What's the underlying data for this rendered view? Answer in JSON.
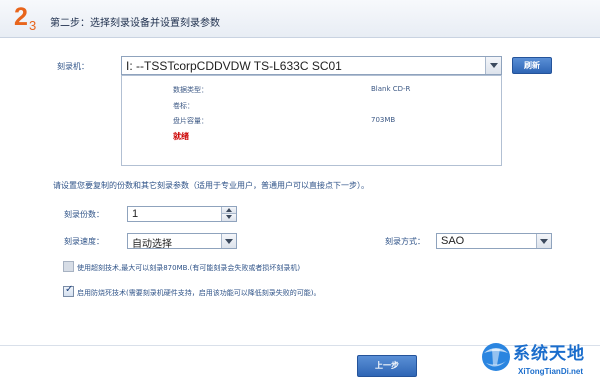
{
  "header": {
    "step_current": "2",
    "step_total": "3",
    "title": "第二步：选择刻录设备并设置刻录参数"
  },
  "burner": {
    "label": "刻录机：",
    "selected": "I:  --TSSTcorpCDDVDW TS-L633C  SC01",
    "refresh_label": "刷新"
  },
  "disc_info": {
    "data_type_label": "数据类型：",
    "data_type_value": "Blank CD-R",
    "volume_label_label": "卷标：",
    "capacity_label": "盘片容量：",
    "capacity_value": "703MB",
    "status": "就绪",
    "status_color": "#cc0000"
  },
  "note": "请设置您要复制的份数和其它刻录参数（适用于专业用户，普通用户可以直接点下一步）。",
  "copies": {
    "label": "刻录份数：",
    "value": "1"
  },
  "speed": {
    "label": "刻录速度：",
    "value": "自动选择"
  },
  "method": {
    "label": "刻录方式：",
    "value": "SAO"
  },
  "options": [
    {
      "text": "使用超刻技术,最大可以刻录870MB.(有可能刻录会失败或者损坏刻录机)",
      "checked": false,
      "enabled": false
    },
    {
      "text": "启用防烧死技术(需要刻录机硬件支持，启用该功能可以降低刻录失败的可能)。",
      "checked": true,
      "enabled": true
    }
  ],
  "next_label": "上一步",
  "watermark": {
    "title": "系统天地",
    "subtitle": "XiTongTianDi.net"
  },
  "colors": {
    "accent": "#e8651c",
    "button": "#2f66b5",
    "label": "#2f5388"
  }
}
